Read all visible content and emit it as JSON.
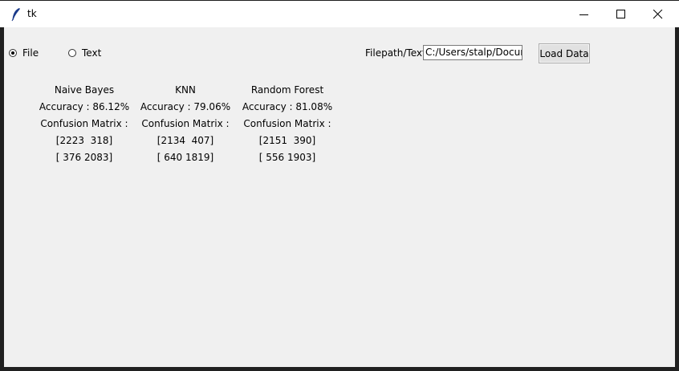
{
  "window": {
    "title": "tk",
    "controls": {
      "minimize_icon": "minimize-icon",
      "maximize_icon": "maximize-icon",
      "close_icon": "close-icon"
    }
  },
  "input_mode": {
    "options": [
      {
        "label": "File",
        "selected": true
      },
      {
        "label": "Text",
        "selected": false
      }
    ]
  },
  "path": {
    "label": "Filepath/Text",
    "value": "C:/Users/stalp/Documents"
  },
  "load_button": {
    "label": "Load Data"
  },
  "results": [
    {
      "model": "Naive Bayes",
      "accuracy": "Accuracy : 86.12%",
      "matrix_label": "Confusion Matrix :",
      "row1": "[2223  318]",
      "row2": "[ 376 2083]"
    },
    {
      "model": "KNN",
      "accuracy": "Accuracy : 79.06%",
      "matrix_label": "Confusion Matrix :",
      "row1": "[2134  407]",
      "row2": "[ 640 1819]"
    },
    {
      "model": "Random Forest",
      "accuracy": "Accuracy : 81.08%",
      "matrix_label": "Confusion Matrix :",
      "row1": "[2151  390]",
      "row2": "[ 556 1903]"
    }
  ]
}
